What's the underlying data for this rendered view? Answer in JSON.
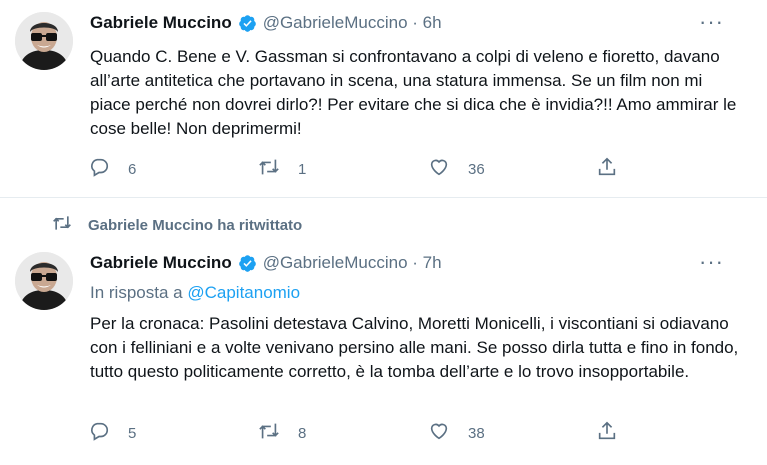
{
  "tweets": [
    {
      "author_name": "Gabriele Muccino",
      "handle_time": "@GabrieleMuccino · 6h",
      "text": "Quando C. Bene e V. Gassman si confrontavano a colpi di veleno e fioretto, davano all’arte antitetica che portavano in scena, una statura immensa. Se un film non mi piace perché non dovrei dirlo?! Per evitare che si dica che è invidia?!! Amo ammirar le cose belle! Non deprimermi!",
      "replies": "6",
      "retweets": "1",
      "likes": "36"
    },
    {
      "author_name": "Gabriele Muccino",
      "handle_time": "@GabrieleMuccino · 7h",
      "reply_prefix": "In risposta a",
      "reply_mention": "@Capitanomio",
      "text": "Per la cronaca: Pasolini detestava Calvino, Moretti Monicelli, i viscontiani si odiavano con i felliniani e a volte venivano persino alle mani. Se posso dirla tutta e fino in fondo, tutto questo politicamente corretto, è la tomba dell’arte e lo trovo insopportabile.",
      "replies": "5",
      "retweets": "8",
      "likes": "38"
    }
  ],
  "retweet_context": "Gabriele Muccino ha ritwittato",
  "icons": {
    "verified": "verified-badge-icon",
    "more": "more-options-icon",
    "reply": "reply-icon",
    "retweet": "retweet-icon",
    "like": "like-icon",
    "share": "share-icon"
  },
  "colors": {
    "accent": "#1da1f2",
    "secondary_text": "#5b7083",
    "primary_text": "#0f1419",
    "divider": "#e6ecf0"
  }
}
